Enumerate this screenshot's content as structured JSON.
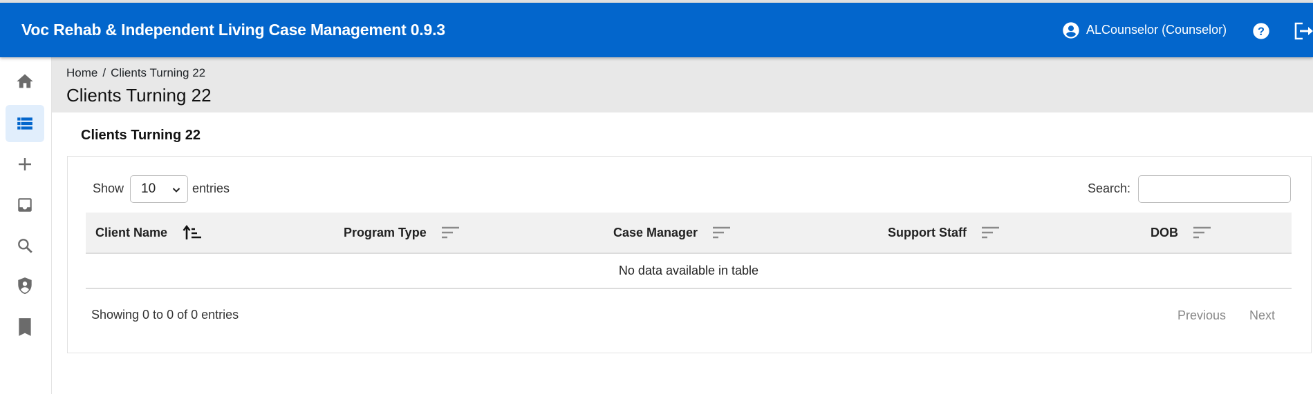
{
  "header": {
    "app_title": "Voc Rehab & Independent Living Case Management 0.9.3",
    "user_label": "ALCounselor (Counselor)",
    "icons": [
      "account-circle-icon",
      "help-circle-icon",
      "logout-icon"
    ]
  },
  "sidebar": {
    "items": [
      {
        "name": "home",
        "icon": "home-icon",
        "active": false
      },
      {
        "name": "list",
        "icon": "list-icon",
        "active": true
      },
      {
        "name": "add",
        "icon": "plus-icon",
        "active": false
      },
      {
        "name": "inbox",
        "icon": "inbox-icon",
        "active": false
      },
      {
        "name": "search",
        "icon": "search-icon",
        "active": false
      },
      {
        "name": "admin",
        "icon": "shield-person-icon",
        "active": false
      },
      {
        "name": "bookmarks",
        "icon": "bookmark-icon",
        "active": false
      }
    ]
  },
  "breadcrumb": {
    "home": "Home",
    "separator": "/",
    "current": "Clients Turning 22"
  },
  "page_title": "Clients Turning 22",
  "section_title": "Clients Turning 22",
  "table_controls": {
    "show_label": "Show",
    "page_length": "10",
    "entries_label": "entries",
    "search_label": "Search:",
    "search_value": "",
    "search_placeholder": ""
  },
  "table": {
    "columns": [
      {
        "label": "Client Name",
        "sort": "ascending"
      },
      {
        "label": "Program Type",
        "sort": "none"
      },
      {
        "label": "Case Manager",
        "sort": "none"
      },
      {
        "label": "Support Staff",
        "sort": "none"
      },
      {
        "label": "DOB",
        "sort": "none"
      }
    ],
    "rows": [],
    "empty_message": "No data available in table"
  },
  "footer": {
    "info": "Showing 0 to 0 of 0 entries",
    "previous": "Previous",
    "next": "Next"
  },
  "colors": {
    "header_bg": "#0366cc",
    "active_nav_bg": "#e1eefc",
    "active_nav_icon": "#0366cc",
    "nav_icon": "#6b6b6b"
  }
}
